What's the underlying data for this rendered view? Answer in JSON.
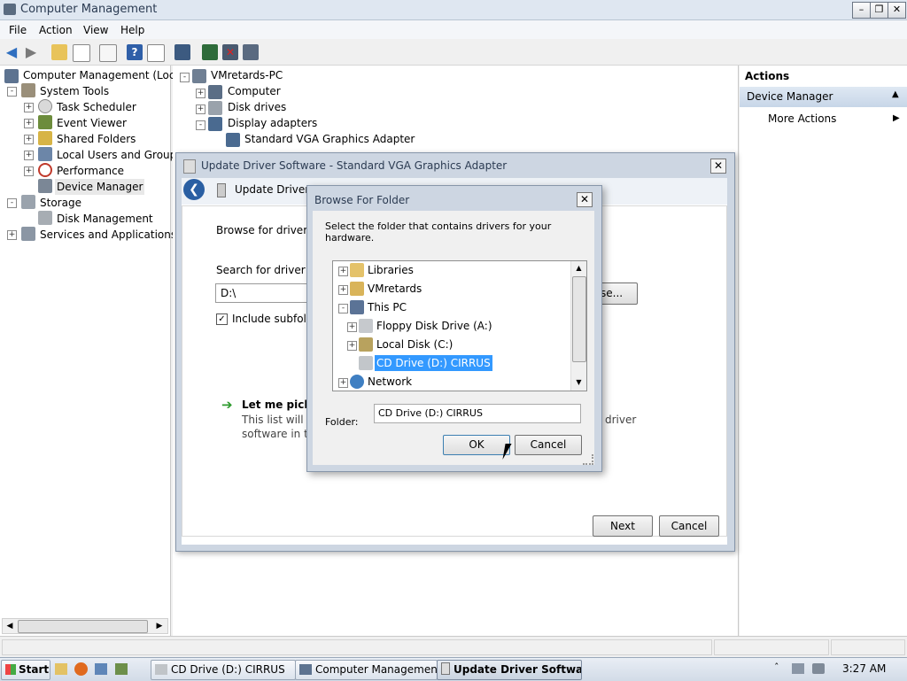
{
  "window": {
    "title": "Computer Management"
  },
  "menu": [
    "File",
    "Action",
    "View",
    "Help"
  ],
  "left_tree": {
    "root": "Computer Management (Local",
    "system_tools": "System Tools",
    "task_scheduler": "Task Scheduler",
    "event_viewer": "Event Viewer",
    "shared_folders": "Shared Folders",
    "local_users": "Local Users and Groups",
    "performance": "Performance",
    "device_manager": "Device Manager",
    "storage": "Storage",
    "disk_management": "Disk Management",
    "services": "Services and Applications"
  },
  "device_tree": {
    "pc": "VMretards-PC",
    "computer": "Computer",
    "disk_drives": "Disk drives",
    "display_adapters": "Display adapters",
    "vga": "Standard VGA Graphics Adapter"
  },
  "actions": {
    "header": "Actions",
    "device_manager": "Device Manager",
    "more_actions": "More Actions"
  },
  "update_dialog": {
    "title": "Update Driver Software - Standard VGA Graphics Adapter",
    "nav_title": "Update Driver S",
    "browse_text": "Browse for driver sc",
    "search_text": "Search for driver sc",
    "path_value": "D:\\",
    "browse_btn": "se...",
    "include_subfolders": "Include subfolde",
    "pick_title": "Let me pick f",
    "pick_desc_1": "This list will sh",
    "pick_desc_1b": "driver",
    "pick_desc_2": "software in th",
    "next": "Next",
    "cancel": "Cancel"
  },
  "browse_dialog": {
    "title": "Browse For Folder",
    "instruction": "Select the folder that contains drivers for your hardware.",
    "items": {
      "libraries": "Libraries",
      "vmretards": "VMretards",
      "this_pc": "This PC",
      "floppy": "Floppy Disk Drive (A:)",
      "local_disk": "Local Disk (C:)",
      "cd_drive": "CD Drive (D:) CIRRUS",
      "network": "Network"
    },
    "folder_label": "Folder:",
    "folder_value": "CD Drive (D:) CIRRUS",
    "ok": "OK",
    "cancel": "Cancel"
  },
  "taskbar": {
    "start": "Start",
    "tasks": [
      "CD Drive (D:) CIRRUS",
      "Computer Management",
      "Update Driver Softwa..."
    ],
    "clock": "3:27 AM"
  },
  "colors": {
    "selection": "#3399ff",
    "accent": "#2b6bb0"
  }
}
